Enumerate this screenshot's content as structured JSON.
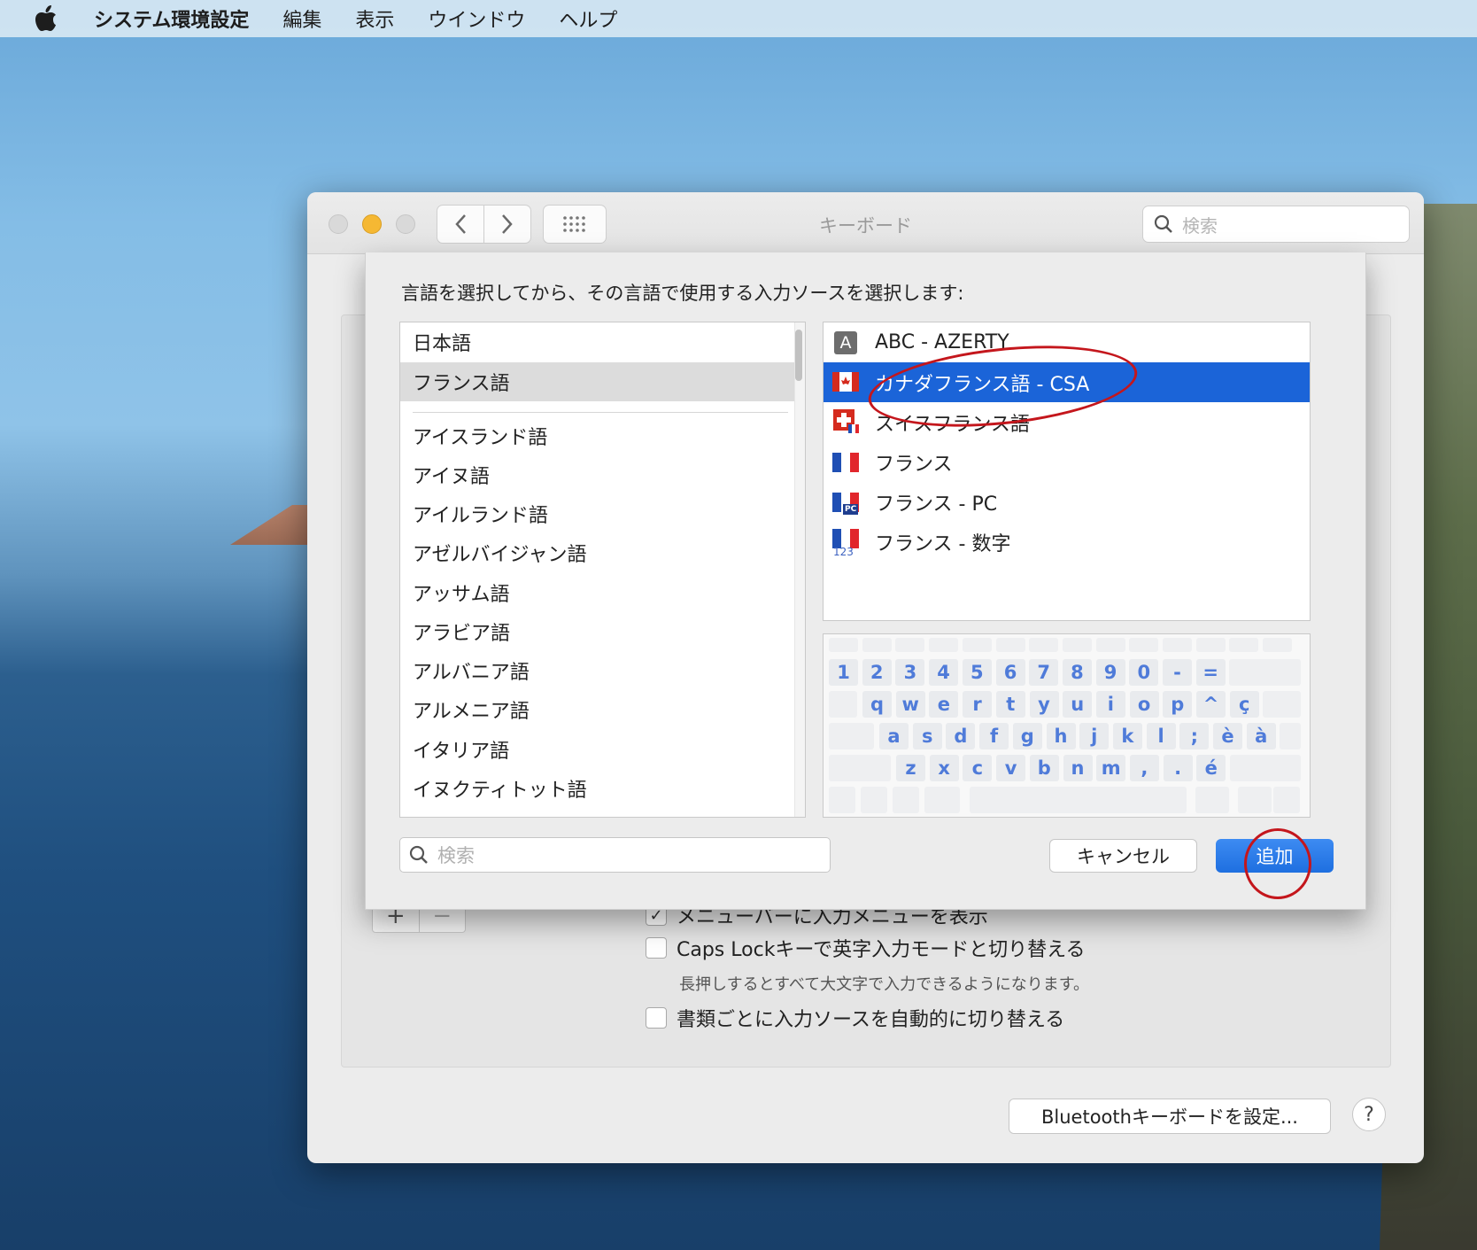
{
  "menubar": {
    "app": "システム環境設定",
    "items": [
      "編集",
      "表示",
      "ウインドウ",
      "ヘルプ"
    ]
  },
  "window": {
    "title": "キーボード",
    "search_placeholder": "検索"
  },
  "sheet": {
    "prompt": "言語を選択してから、その言語で使用する入力ソースを選択します:",
    "preferred_languages": [
      "日本語",
      "フランス語"
    ],
    "selected_language": "フランス語",
    "languages": [
      "アイスランド語",
      "アイヌ語",
      "アイルランド語",
      "アゼルバイジャン語",
      "アッサム語",
      "アラビア語",
      "アルバニア語",
      "アルメニア語",
      "イタリア語",
      "イヌクティトット語"
    ],
    "sources": [
      {
        "label": "ABC - AZERTY",
        "icon": "abc-icon"
      },
      {
        "label": "カナダフランス語 - CSA",
        "icon": "canada-flag-icon",
        "selected": true
      },
      {
        "label": "スイスフランス語",
        "icon": "swiss-flag-icon"
      },
      {
        "label": "フランス",
        "icon": "france-flag-icon"
      },
      {
        "label": "フランス - PC",
        "icon": "france-pc-flag-icon"
      },
      {
        "label": "フランス - 数字",
        "icon": "france-numeric-flag-icon"
      }
    ],
    "keyboard_rows": [
      [
        "1",
        "2",
        "3",
        "4",
        "5",
        "6",
        "7",
        "8",
        "9",
        "0",
        "-",
        "="
      ],
      [
        "q",
        "w",
        "e",
        "r",
        "t",
        "y",
        "u",
        "i",
        "o",
        "p",
        "^",
        "ç"
      ],
      [
        "a",
        "s",
        "d",
        "f",
        "g",
        "h",
        "j",
        "k",
        "l",
        ";",
        "è",
        "à"
      ],
      [
        "z",
        "x",
        "c",
        "v",
        "b",
        "n",
        "m",
        ",",
        ".",
        "é"
      ]
    ],
    "search_placeholder": "検索",
    "cancel_label": "キャンセル",
    "add_label": "追加",
    "badges": {
      "abc": "A",
      "pc": "PC",
      "num": "123"
    }
  },
  "pane": {
    "plus": "+",
    "minus": "−",
    "check_mark": "✓",
    "option_menu": "メニューバーに入力メニューを表示",
    "option_capslock": "Caps Lockキーで英字入力モードと切り替える",
    "option_capslock_hint": "長押しするとすべて大文字で入力できるようになります。",
    "option_auto_switch": "書類ごとに入力ソースを自動的に切り替える",
    "bluetooth_label": "Bluetoothキーボードを設定...",
    "help_label": "?"
  },
  "colors": {
    "accent": "#1b64d8",
    "annotation": "#c4161c"
  }
}
